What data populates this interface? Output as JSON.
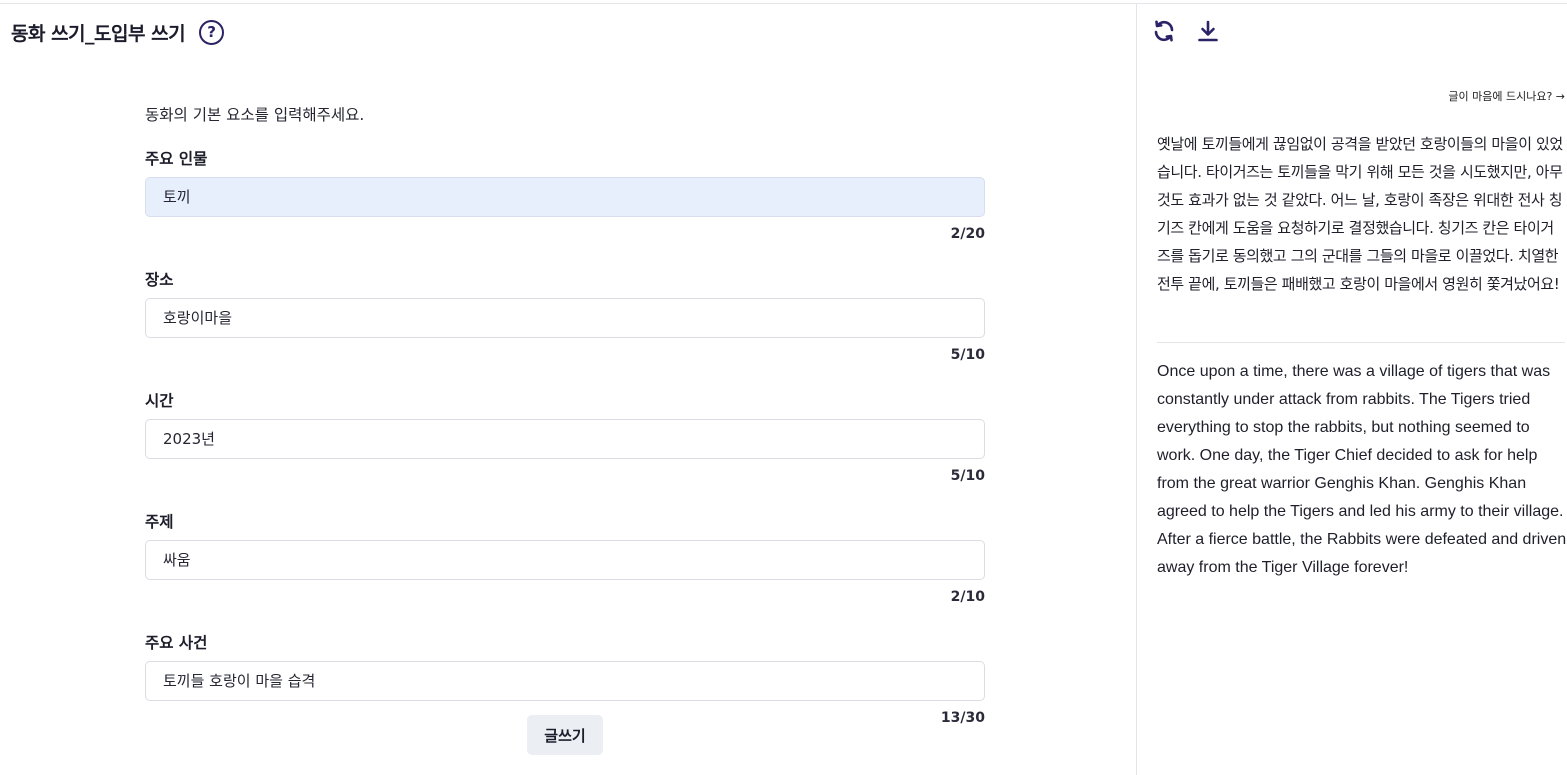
{
  "header": {
    "title": "동화 쓰기_도입부 쓰기",
    "help_icon": "?"
  },
  "form": {
    "intro": "동화의 기본 요소를 입력해주세요.",
    "fields": [
      {
        "label": "주요 인물",
        "value": "토끼",
        "counter": "2/20"
      },
      {
        "label": "장소",
        "value": "호랑이마을",
        "counter": "5/10"
      },
      {
        "label": "시간",
        "value": "2023년",
        "counter": "5/10"
      },
      {
        "label": "주제",
        "value": "싸움",
        "counter": "2/10"
      },
      {
        "label": "주요 사건",
        "value": "토끼들 호랑이 마을 습격",
        "counter": "13/30"
      }
    ],
    "submit_label": "글쓰기"
  },
  "result": {
    "toolbar": {
      "refresh_icon": "refresh-icon",
      "download_icon": "download-icon"
    },
    "feedback_link": "글이 마음에 드시나요? →",
    "story_ko": "옛날에 토끼들에게 끊임없이 공격을 받았던 호랑이들의 마을이 있었습니다. 타이거즈는 토끼들을 막기 위해 모든 것을 시도했지만, 아무 것도 효과가 없는 것 같았다. 어느 날, 호랑이 족장은 위대한 전사 칭기즈 칸에게 도움을 요청하기로 결정했습니다. 칭기즈 칸은 타이거즈를 돕기로 동의했고 그의 군대를 그들의 마을로 이끌었다. 치열한 전투 끝에, 토끼들은 패배했고 호랑이 마을에서 영원히 쫓겨났어요!",
    "story_en": "Once upon a time, there was a village of tigers that was constantly under attack from rabbits. The Tigers tried everything to stop the rabbits, but nothing seemed to work. One day, the Tiger Chief decided to ask for help from the great warrior Genghis Khan. Genghis Khan agreed to help the Tigers and led his army to their village. After a fierce battle, the Rabbits were defeated and driven away from the Tiger Village forever!"
  },
  "colors": {
    "accent": "#2a2366",
    "focused_input": "#e7effc",
    "button_bg": "#ebeff3"
  }
}
